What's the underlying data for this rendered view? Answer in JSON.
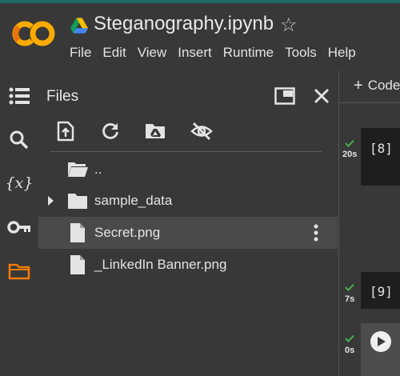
{
  "header": {
    "doc_title": "Steganography.ipynb",
    "star_glyph": "☆",
    "menu": [
      "File",
      "Edit",
      "View",
      "Insert",
      "Runtime",
      "Tools",
      "Help"
    ]
  },
  "rail": {
    "icons": [
      "table-of-contents-icon",
      "search-icon",
      "variables-icon",
      "secrets-key-icon",
      "files-folder-icon"
    ],
    "variables_label": "{x}"
  },
  "files_panel": {
    "title": "Files",
    "toolbar": [
      "upload-file-icon",
      "refresh-icon",
      "mount-drive-icon",
      "hide-files-icon"
    ],
    "entries": [
      {
        "label": "..",
        "kind": "parent-folder",
        "selected": false
      },
      {
        "label": "sample_data",
        "kind": "folder",
        "selected": false
      },
      {
        "label": "Secret.png",
        "kind": "file",
        "selected": true
      },
      {
        "label": "_LinkedIn Banner.png",
        "kind": "file",
        "selected": false
      }
    ]
  },
  "notebook": {
    "add_code_plus": "+",
    "add_code_label": "Code",
    "cells": [
      {
        "exec_time": "20s",
        "number": "[8]"
      },
      {
        "exec_time": "7s",
        "number": "[9]"
      },
      {
        "exec_time": "0s",
        "number": ""
      }
    ]
  },
  "colors": {
    "background": "#383838",
    "accent_teal": "#1f6b63",
    "logo_orange": "#f9ab00",
    "active_rail_orange": "#f57c00",
    "success_green": "#4caf50",
    "selected_row": "#4a4a4a"
  }
}
